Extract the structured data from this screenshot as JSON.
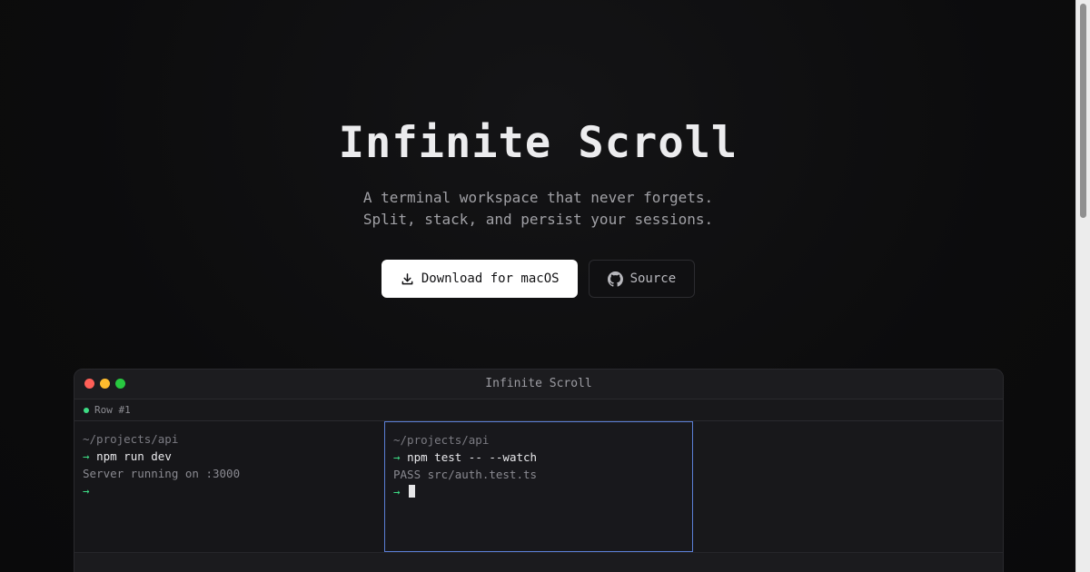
{
  "hero": {
    "title": "Infinite Scroll",
    "subtitle_line1": "A terminal workspace that never forgets.",
    "subtitle_line2": "Split, stack, and persist your sessions."
  },
  "actions": {
    "download_label": "Download for macOS",
    "download_icon": "download-icon",
    "source_label": "Source",
    "source_icon": "github-icon"
  },
  "window": {
    "title": "Infinite Scroll",
    "row_label": "Row #1",
    "panes": [
      {
        "path": "~/projects/api",
        "arrow": "→",
        "command": "npm run dev",
        "output": "Server running on :3000"
      },
      {
        "path": "~/projects/api",
        "arrow": "→",
        "command": "npm test -- --watch",
        "output": "PASS src/auth.test.ts"
      }
    ]
  },
  "colors": {
    "accent_green": "#3ddc84",
    "focus_border": "#5b7fd6",
    "background": "#0d0d0e"
  }
}
